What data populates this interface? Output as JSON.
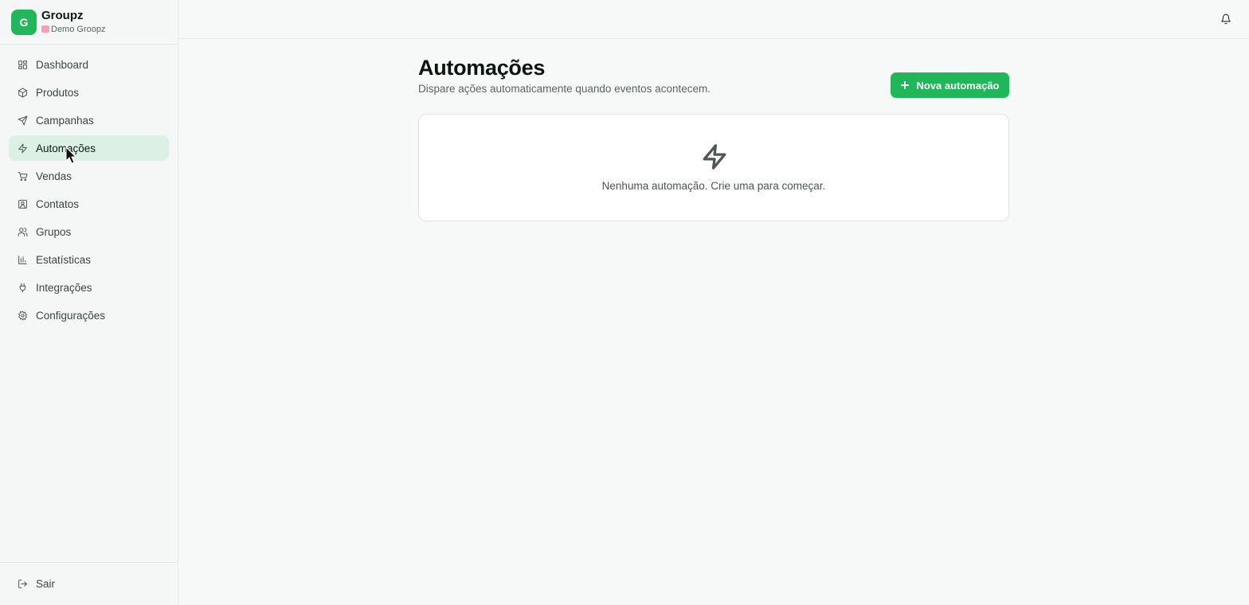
{
  "brand": {
    "logo_letter": "G",
    "name": "Groupz",
    "org": "Demo Groopz"
  },
  "sidebar": {
    "items": [
      {
        "label": "Dashboard",
        "icon": "dashboard-icon",
        "active": false
      },
      {
        "label": "Produtos",
        "icon": "package-icon",
        "active": false
      },
      {
        "label": "Campanhas",
        "icon": "send-icon",
        "active": false
      },
      {
        "label": "Automações",
        "icon": "zap-icon",
        "active": true
      },
      {
        "label": "Vendas",
        "icon": "cart-icon",
        "active": false
      },
      {
        "label": "Contatos",
        "icon": "contact-icon",
        "active": false
      },
      {
        "label": "Grupos",
        "icon": "users-icon",
        "active": false
      },
      {
        "label": "Estatísticas",
        "icon": "bar-chart-icon",
        "active": false
      },
      {
        "label": "Integrações",
        "icon": "plug-icon",
        "active": false
      },
      {
        "label": "Configurações",
        "icon": "gear-icon",
        "active": false
      }
    ],
    "logout_label": "Sair"
  },
  "main": {
    "title": "Automações",
    "subtitle": "Dispare ações automaticamente quando eventos acontecem.",
    "new_button_label": "Nova automação",
    "empty_text": "Nenhuma automação. Crie uma para começar."
  },
  "colors": {
    "accent": "#20b65a",
    "active_nav_bg": "#dcf1e3",
    "page_bg": "#f7f9f8"
  }
}
